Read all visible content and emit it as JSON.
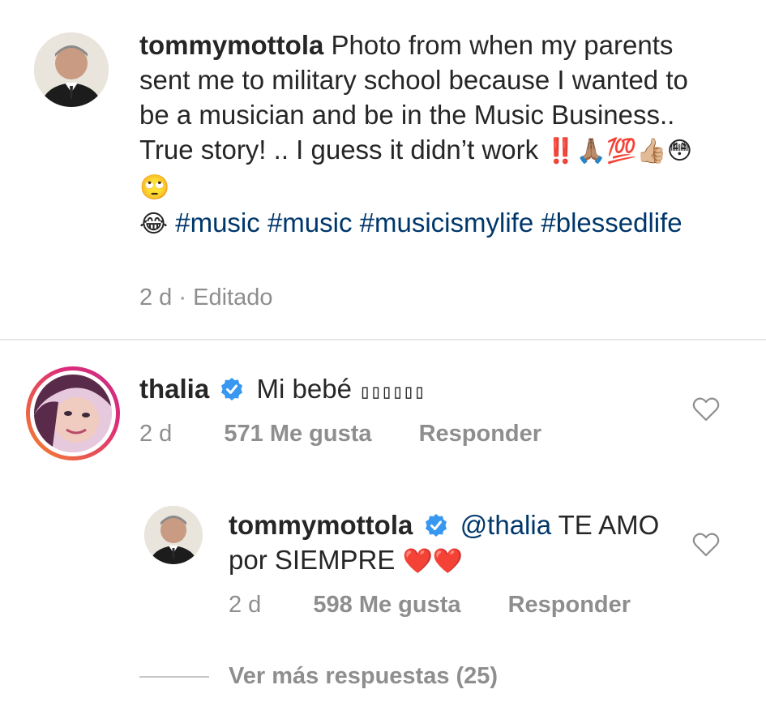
{
  "post_caption": {
    "username": "tommymottola",
    "text": "Photo from when my parents sent me to military school because I wanted to be a musician and be in the Music Business.. True story! .. I guess it didn’t work",
    "emojis_line": "‼️🙏🏽💯👍🏼😳🙄",
    "emoji_lead": "😂",
    "hashtags": [
      "#music",
      "#music",
      "#musicismylife",
      "#blessedlife"
    ],
    "time": "2 d",
    "edited": "Editado",
    "separator": "·"
  },
  "comment": {
    "username": "thalia",
    "text": "Mi bebé ",
    "text_tail": "▯▯▯▯▯▯",
    "time": "2 d",
    "likes": "571 Me gusta",
    "reply": "Responder",
    "like_icon": "heart-outline-icon"
  },
  "reply": {
    "username": "tommymottola",
    "mention": "@thalia",
    "text": " TE AMO por SIEMPRE ",
    "hearts": "❤️❤️",
    "time": "2 d",
    "likes": "598 Me gusta",
    "reply": "Responder",
    "like_icon": "heart-outline-icon"
  },
  "more_replies": "Ver más respuestas (25)",
  "colors": {
    "text": "#262626",
    "muted": "#8e8e8e",
    "link": "#00376b",
    "verified": "#3897f0",
    "story_ring_start": "#f58529",
    "story_ring_end": "#dd2a7b"
  }
}
